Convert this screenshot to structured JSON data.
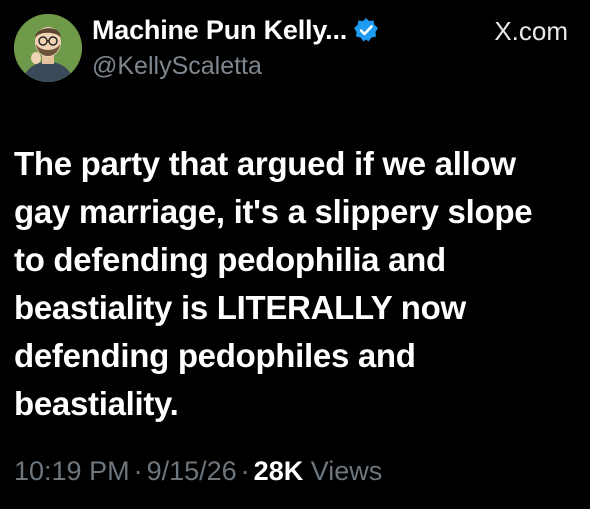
{
  "author": {
    "display_name": "Machine Pun Kelly...",
    "handle": "@KellyScaletta",
    "verified": true
  },
  "source": "X.com",
  "tweet": {
    "text": "The party that argued if we allow\ngay marriage, it's a slippery slope\nto defending pedophilia and\nbeastiality is LITERALLY now\ndefending pedophiles and\nbeastiality."
  },
  "meta": {
    "time": "10:19 PM",
    "separator": "·",
    "date": "9/15/26",
    "views_count": "28K",
    "views_label": "Views"
  },
  "colors": {
    "background": "#000000",
    "text": "#ffffff",
    "secondary": "#7e868e",
    "verified": "#1d9bf0",
    "avatar_bg": "#6f9a4a"
  },
  "icons": {
    "avatar": "cartoon-bearded-man-avatar",
    "verified": "verified-badge-icon"
  }
}
